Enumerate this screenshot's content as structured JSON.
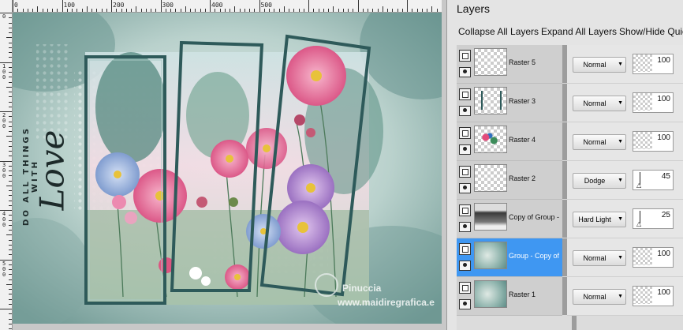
{
  "ruler": {
    "top_labels": [
      "0",
      "100",
      "200",
      "300",
      "400",
      "500"
    ],
    "left_labels": [
      "0",
      "1\n0\n0",
      "2\n0\n0",
      "3\n0\n0",
      "4\n0\n0",
      "5\n0\n0"
    ]
  },
  "artwork": {
    "vertical_text": "DO ALL THINGS WITH",
    "script_word": "Love",
    "watermark_name": "Pinuccia",
    "watermark_url": "www.maidiregrafica.e"
  },
  "panel": {
    "title": "Layers",
    "toolbar": {
      "collapse_label": "Collapse All Layers",
      "expand_label": "Expand All Layers",
      "showhide_label": "Show/Hide Quic"
    },
    "layers": [
      {
        "name": "Raster 5",
        "blend": "Normal",
        "opacity": "100",
        "thumb": "empty",
        "selected": false
      },
      {
        "name": "Raster 3",
        "blend": "Normal",
        "opacity": "100",
        "thumb": "frames",
        "selected": false
      },
      {
        "name": "Raster 4",
        "blend": "Normal",
        "opacity": "100",
        "thumb": "flowers",
        "selected": false
      },
      {
        "name": "Raster 2",
        "blend": "Dodge",
        "opacity": "45",
        "thumb": "empty",
        "selected": false
      },
      {
        "name": "Copy of Group - C",
        "blend": "Hard Light",
        "opacity": "25",
        "thumb": "dark",
        "selected": false
      },
      {
        "name": "Group - Copy of R",
        "blend": "Normal",
        "opacity": "100",
        "thumb": "teal",
        "selected": true
      },
      {
        "name": "Raster 1",
        "blend": "Normal",
        "opacity": "100",
        "thumb": "teal",
        "selected": false
      }
    ]
  },
  "colors": {
    "selection": "#3f97f2",
    "frame": "#2e5a5a"
  }
}
